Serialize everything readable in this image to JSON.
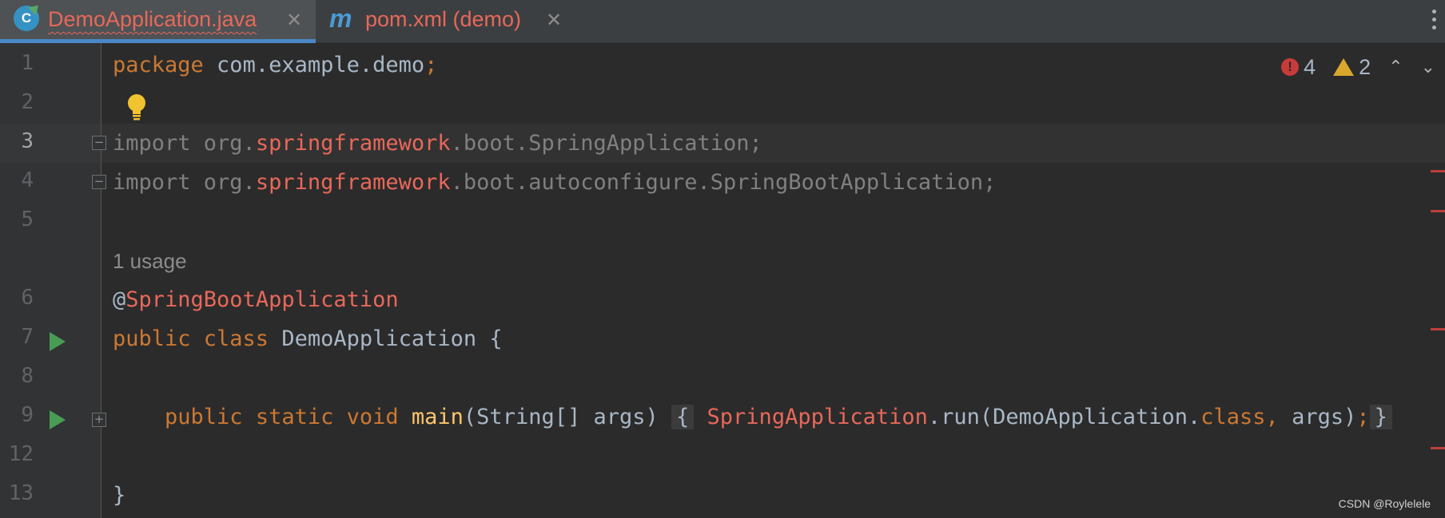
{
  "tabs": [
    {
      "label": "DemoApplication.java",
      "icon": "java-class-icon",
      "icon_letter": "C",
      "active": true,
      "close": "✕"
    },
    {
      "label": "pom.xml (demo)",
      "icon": "maven-icon",
      "icon_letter": "m",
      "active": false,
      "close": "✕"
    }
  ],
  "inspections": {
    "errors": "4",
    "warnings": "2",
    "error_glyph": "!"
  },
  "gutter": {
    "line_numbers": [
      "1",
      "2",
      "3",
      "4",
      "5",
      "6",
      "7",
      "8",
      "9",
      "12",
      "13"
    ],
    "current_line": "3"
  },
  "code": {
    "l1_package_kw": "package",
    "l1_rest": " com.example.demo",
    "l1_semicolon": ";",
    "l3_import": "import org.",
    "l3_err": "springframework",
    "l3_rest": ".boot.SpringApplication;",
    "l4_import": "import org.",
    "l4_err": "springframework",
    "l4_rest": ".boot.autoconfigure.SpringBootApplication;",
    "usage_hint": "1 usage",
    "l6_at": "@",
    "l6_ann": "SpringBootApplication",
    "l7_kw": "public class",
    "l7_rest": " DemoApplication {",
    "l9_indent": "    ",
    "l9_kw": "public static void",
    "l9_fn": " main",
    "l9_params": "(String[] args) ",
    "l9_open": "{",
    "l9_err": " SpringApplication",
    "l9_call": ".run(DemoApplication.",
    "l9_class_kw": "class,",
    "l9_args": " args)",
    "l9_semicolon": ";",
    "l9_close": "}",
    "l13_brace": "}"
  },
  "watermark": "CSDN @Roylelele",
  "colors": {
    "keyword": "#cc7832",
    "error": "#e8685a",
    "text": "#a9b7c6",
    "background": "#2b2b2b"
  }
}
